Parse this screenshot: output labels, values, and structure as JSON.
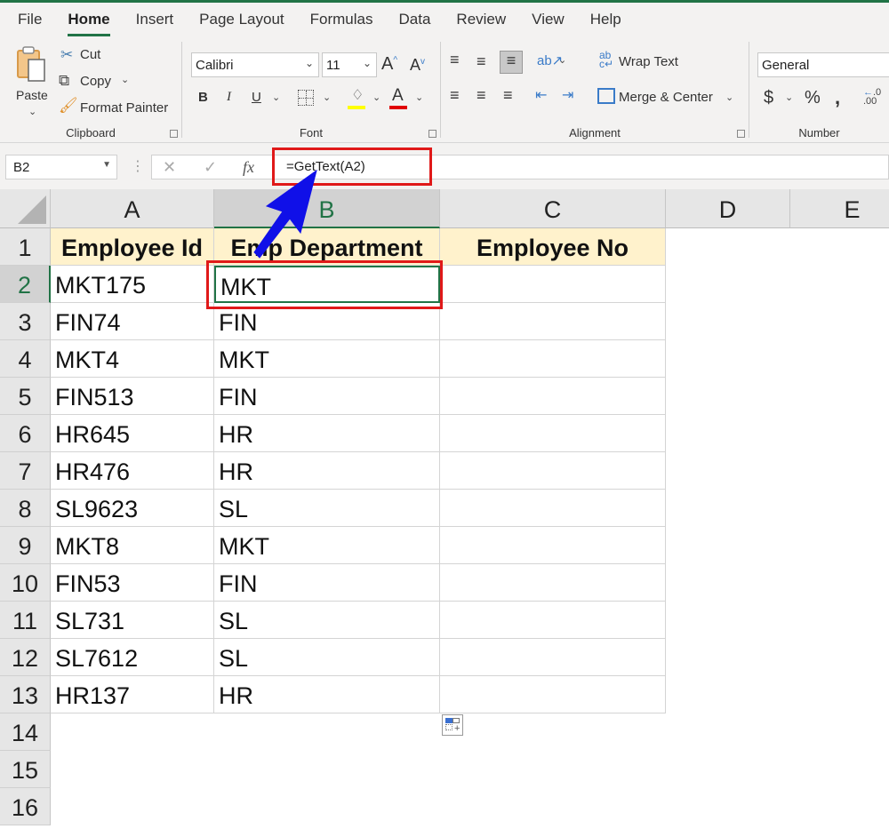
{
  "ribbon_tabs": [
    "File",
    "Home",
    "Insert",
    "Page Layout",
    "Formulas",
    "Data",
    "Review",
    "View",
    "Help"
  ],
  "active_tab": "Home",
  "clipboard": {
    "paste_label": "Paste",
    "cut_label": "Cut",
    "copy_label": "Copy",
    "format_painter_label": "Format Painter",
    "group_label": "Clipboard"
  },
  "font": {
    "font_name": "Calibri",
    "font_size": "11",
    "bold": "B",
    "italic": "I",
    "underline": "U",
    "group_label": "Font",
    "fill_color": "#ffff00",
    "font_color": "#e00000"
  },
  "alignment": {
    "wrap_text_label": "Wrap Text",
    "merge_center_label": "Merge & Center",
    "group_label": "Alignment"
  },
  "number": {
    "format": "General",
    "currency": "$",
    "percent": "%",
    "comma": "͓",
    "group_label": "Number"
  },
  "formula_bar": {
    "name_box": "B2",
    "formula": "=GetText(A2)"
  },
  "sheet": {
    "columns": [
      "A",
      "B",
      "C",
      "D",
      "E"
    ],
    "selected_column": "B",
    "selected_row": "2",
    "row_numbers": [
      "1",
      "2",
      "3",
      "4",
      "5",
      "6",
      "7",
      "8",
      "9",
      "10",
      "11",
      "12",
      "13",
      "14",
      "15",
      "16"
    ],
    "headers": [
      "Employee Id",
      "Emp Department",
      "Employee No"
    ],
    "rows": [
      [
        "MKT175",
        "MKT",
        ""
      ],
      [
        "FIN74",
        "FIN",
        ""
      ],
      [
        "MKT4",
        "MKT",
        ""
      ],
      [
        "FIN513",
        "FIN",
        ""
      ],
      [
        "HR645",
        "HR",
        ""
      ],
      [
        "HR476",
        "HR",
        ""
      ],
      [
        "SL9623",
        "SL",
        ""
      ],
      [
        "MKT8",
        "MKT",
        ""
      ],
      [
        "FIN53",
        "FIN",
        ""
      ],
      [
        "SL731",
        "SL",
        ""
      ],
      [
        "SL7612",
        "SL",
        ""
      ],
      [
        "HR137",
        "HR",
        ""
      ]
    ]
  },
  "annotation_colors": {
    "highlight_box": "#e01919",
    "arrow": "#1010e8",
    "accent": "#217346",
    "header_fill": "#fff2cc"
  }
}
